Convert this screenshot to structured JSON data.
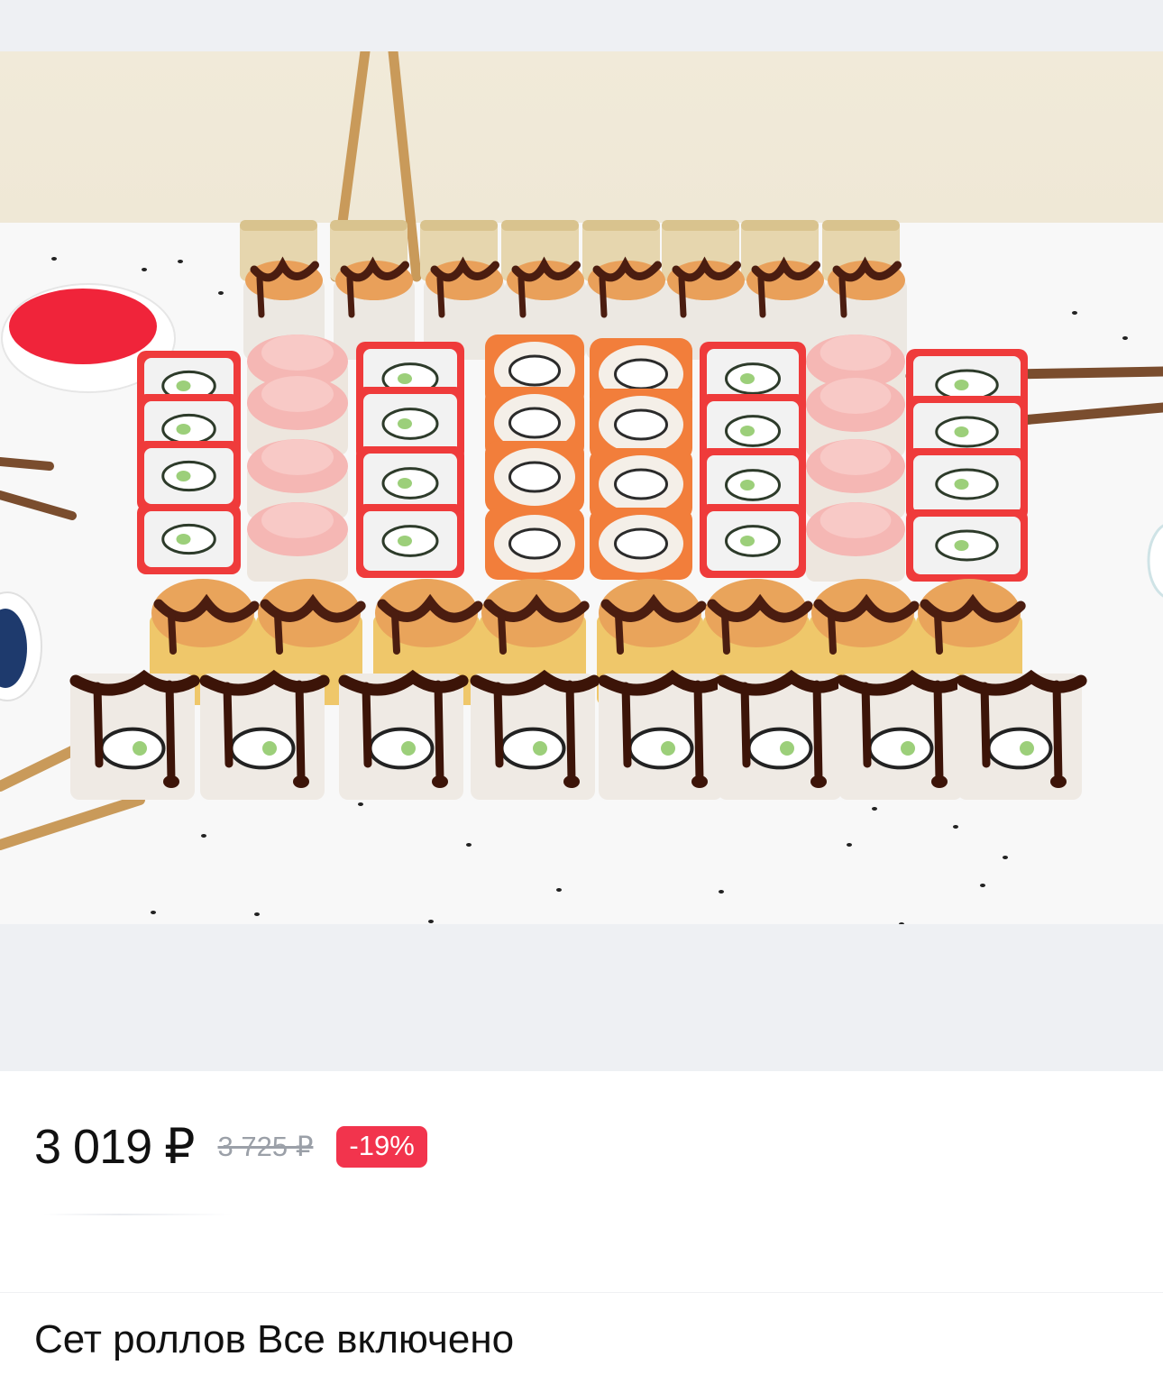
{
  "product": {
    "image_alt": "sushi-set-photo",
    "price_current": "3 019 ₽",
    "price_old": "3 725 ₽",
    "discount": "-19%",
    "title": "Сет роллов Все включено"
  },
  "colors": {
    "discount_badge": "#f2344d",
    "price_text": "#111111",
    "old_price_text": "#9ba0a8",
    "photo_backdrop": "#eef0f3"
  }
}
